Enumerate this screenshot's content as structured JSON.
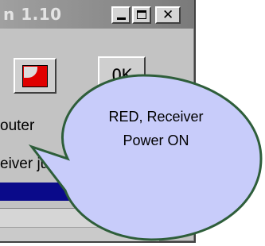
{
  "window": {
    "title": "n 1.10"
  },
  "controls": {
    "ok_label": "OK",
    "indicator_color": "#e00000"
  },
  "labels": {
    "computer": "outer",
    "receiver": "eiver ju"
  },
  "callout": {
    "line1": "RED, Receiver",
    "line2": "Power ON",
    "fill": "#c8ccfa",
    "border": "#2e5e3a"
  },
  "colors": {
    "status_bar": "#0a0a8a",
    "window_bg": "#c3c3c3"
  }
}
